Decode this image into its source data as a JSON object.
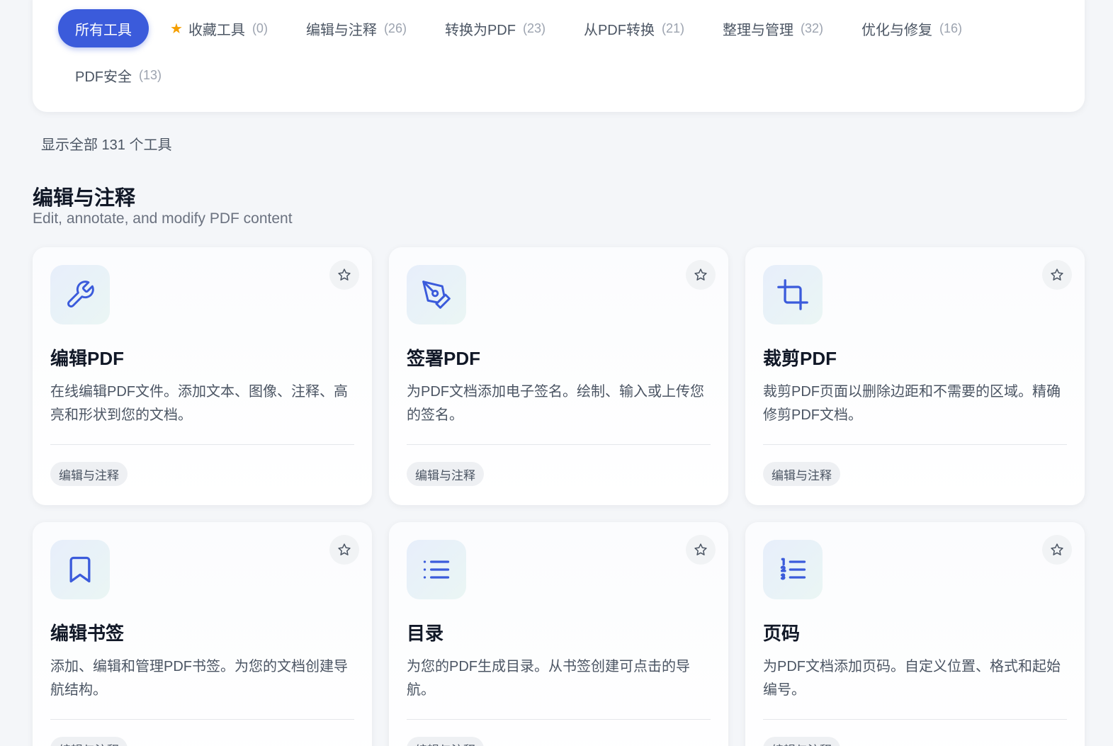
{
  "filter": {
    "tabs": [
      {
        "label": "所有工具",
        "count": "",
        "active": true
      },
      {
        "label": "收藏工具",
        "count": "(0)",
        "icon": "star-icon"
      },
      {
        "label": "编辑与注释",
        "count": "(26)"
      },
      {
        "label": "转换为PDF",
        "count": "(23)"
      },
      {
        "label": "从PDF转换",
        "count": "(21)"
      },
      {
        "label": "整理与管理",
        "count": "(32)"
      },
      {
        "label": "优化与修复",
        "count": "(16)"
      },
      {
        "label": "PDF安全",
        "count": "(13)"
      }
    ]
  },
  "summary": "显示全部 131 个工具",
  "section": {
    "title": "编辑与注释",
    "subtitle": "Edit, annotate, and modify PDF content",
    "tools": [
      {
        "icon": "wrench-icon",
        "title": "编辑PDF",
        "desc": "在线编辑PDF文件。添加文本、图像、注释、高亮和形状到您的文档。",
        "tag": "编辑与注释"
      },
      {
        "icon": "pen-nib-icon",
        "title": "签署PDF",
        "desc": "为PDF文档添加电子签名。绘制、输入或上传您的签名。",
        "tag": "编辑与注释"
      },
      {
        "icon": "crop-icon",
        "title": "裁剪PDF",
        "desc": "裁剪PDF页面以删除边距和不需要的区域。精确修剪PDF文档。",
        "tag": "编辑与注释"
      },
      {
        "icon": "bookmark-icon",
        "title": "编辑书签",
        "desc": "添加、编辑和管理PDF书签。为您的文档创建导航结构。",
        "tag": "编辑与注释"
      },
      {
        "icon": "list-icon",
        "title": "目录",
        "desc": "为您的PDF生成目录。从书签创建可点击的导航。",
        "tag": "编辑与注释"
      },
      {
        "icon": "numbered-list-icon",
        "title": "页码",
        "desc": "为PDF文档添加页码。自定义位置、格式和起始编号。",
        "tag": "编辑与注释"
      }
    ]
  },
  "colors": {
    "accent": "#3b5bdb",
    "star": "#f59f00",
    "icon": "#3b5bdb"
  }
}
